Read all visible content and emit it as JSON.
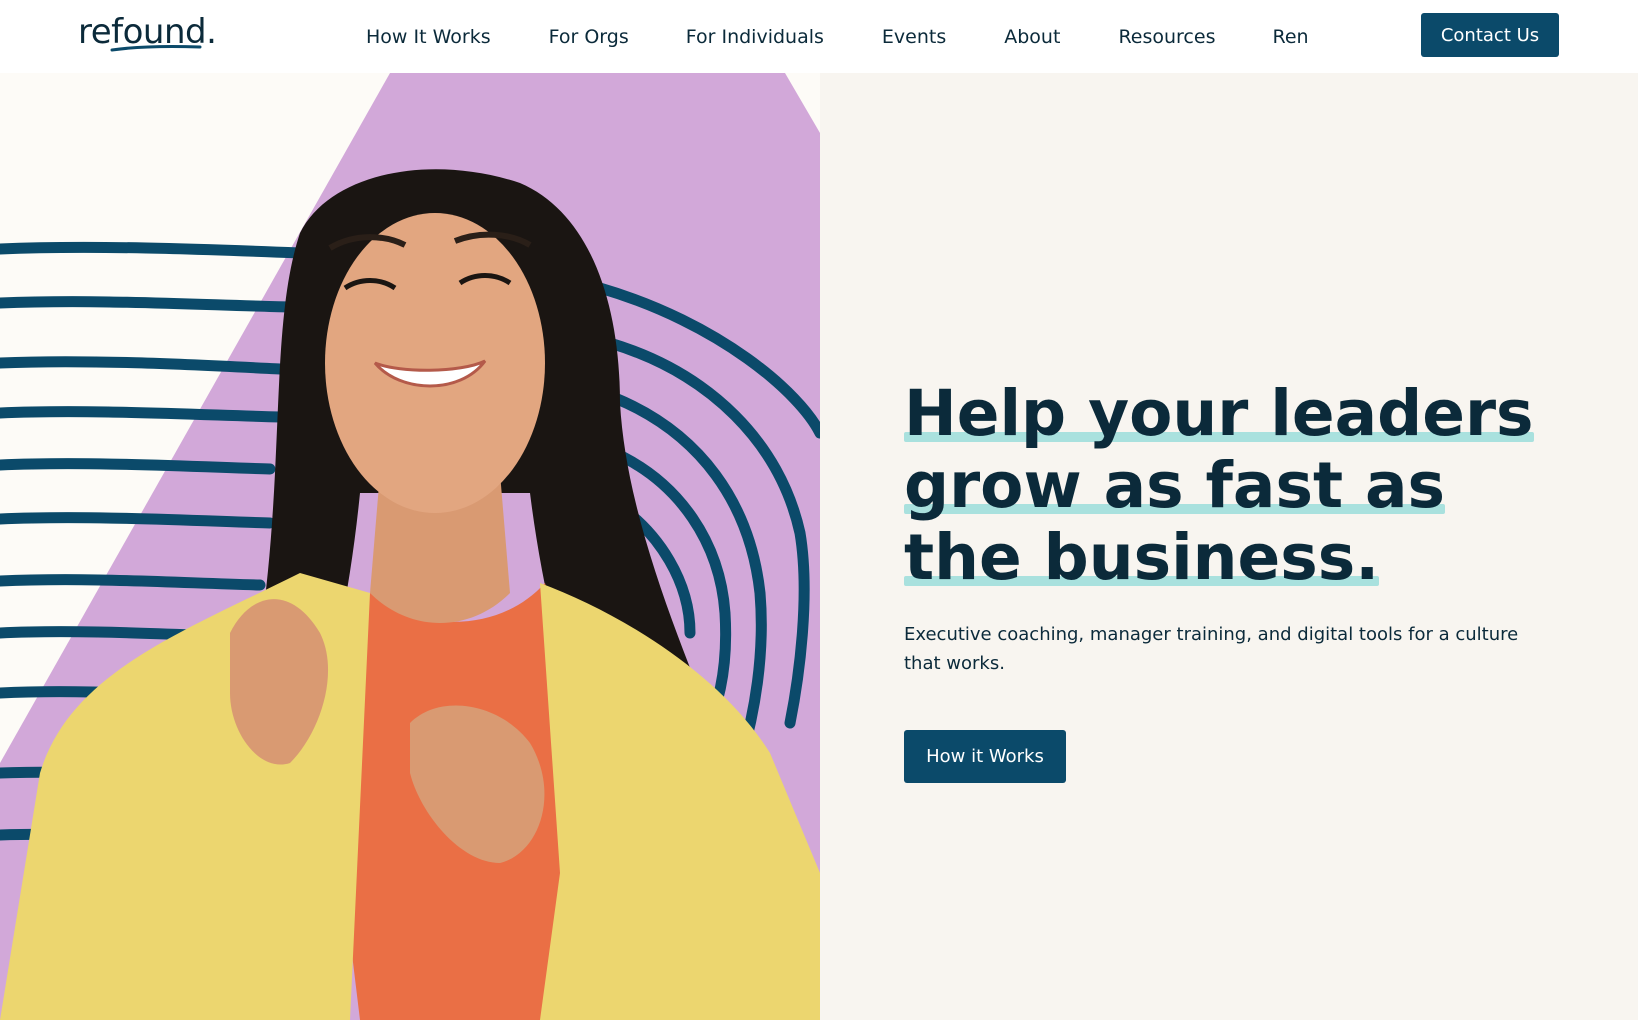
{
  "header": {
    "logo_text": "refound.",
    "nav": [
      {
        "label": "How It Works"
      },
      {
        "label": "For Orgs"
      },
      {
        "label": "For Individuals"
      },
      {
        "label": "Events"
      },
      {
        "label": "About"
      },
      {
        "label": "Resources"
      },
      {
        "label": "Ren"
      }
    ],
    "contact_label": "Contact Us"
  },
  "hero": {
    "headline_lines": [
      "Help your leaders",
      "grow as fast as",
      "the business."
    ],
    "subtext": "Executive coaching, manager training, and digital tools for a culture that works.",
    "cta_label": "How it Works"
  },
  "colors": {
    "brand_dark": "#0b2a3a",
    "button": "#0b4a6a",
    "highlight": "#a9e1de",
    "purple": "#d2a8d9",
    "background": "#f8f5f0"
  }
}
